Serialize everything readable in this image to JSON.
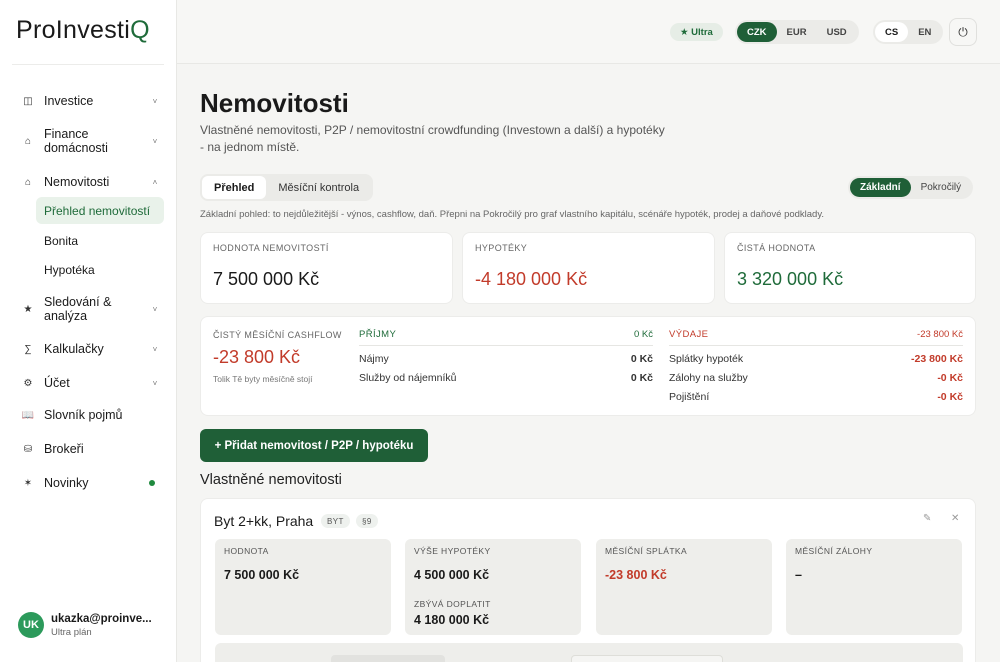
{
  "brand": {
    "name_main": "ProInvesti",
    "name_accent": "Q"
  },
  "sidebar": {
    "items": [
      {
        "id": "investice",
        "icon": "grid-icon",
        "glyph": "◫",
        "label": "Investice",
        "chevron": "˅"
      },
      {
        "id": "finance",
        "icon": "home-icon",
        "glyph": "⌂",
        "label": "Finance domácnosti",
        "chevron": "˅"
      },
      {
        "id": "nemovitosti",
        "icon": "house-icon",
        "glyph": "⌂",
        "label": "Nemovitosti",
        "chevron": "˄"
      },
      {
        "id": "sledovani",
        "icon": "star-icon",
        "glyph": "★",
        "label": "Sledování & analýza",
        "chevron": "˅"
      },
      {
        "id": "kalkulacky",
        "icon": "sigma-icon",
        "glyph": "∑",
        "label": "Kalkulačky",
        "chevron": "˅"
      },
      {
        "id": "ucet",
        "icon": "gear-icon",
        "glyph": "⚙",
        "label": "Účet",
        "chevron": "˅"
      },
      {
        "id": "slovnik",
        "icon": "book-icon",
        "glyph": "📖",
        "label": "Slovník pojmů",
        "chevron": ""
      },
      {
        "id": "brokeri",
        "icon": "database-icon",
        "glyph": "⛁",
        "label": "Brokeři",
        "chevron": ""
      },
      {
        "id": "novinky",
        "icon": "sparkle-icon",
        "glyph": "✶",
        "label": "Novinky",
        "chevron": ""
      }
    ],
    "subitems": [
      {
        "label": "Přehled nemovitostí",
        "active": true
      },
      {
        "label": "Bonita",
        "active": false
      },
      {
        "label": "Hypotéka",
        "active": false
      }
    ],
    "user": {
      "initials": "UK",
      "email": "ukazka@proinve...",
      "plan": "Ultra plán"
    }
  },
  "topbar": {
    "plan_badge": "★ Ultra",
    "currencies": [
      "CZK",
      "EUR",
      "USD"
    ],
    "currency_selected": "CZK",
    "languages": [
      "CS",
      "EN"
    ],
    "language_selected": "CS",
    "power_glyph": "⏻"
  },
  "page": {
    "title": "Nemovitosti",
    "subtitle": "Vlastněné nemovitosti, P2P / nemovitostní crowdfunding (Investown a další) a hypotéky - na jednom místě.",
    "tabs": [
      "Přehled",
      "Měsíční kontrola"
    ],
    "modes": [
      "Základní",
      "Pokročilý"
    ],
    "hint": "Základní pohled: to nejdůležitější - výnos, cashflow, daň. Přepni na Pokročilý pro graf vlastního kapitálu, scénáře hypoték, prodej a daňové podklady."
  },
  "kpis": [
    {
      "label": "HODNOTA NEMOVITOSTÍ",
      "value": "7 500 000 Kč",
      "tone": ""
    },
    {
      "label": "HYPOTÉKY",
      "value": "-4 180 000 Kč",
      "tone": "red"
    },
    {
      "label": "ČISTÁ HODNOTA",
      "value": "3 320 000 Kč",
      "tone": "green"
    }
  ],
  "cashflow": {
    "label": "ČISTÝ MĚSÍČNÍ CASHFLOW",
    "value": "-23 800 Kč",
    "note": "Tolik Tě byty měsíčně stojí",
    "income": {
      "title": "PŘÍJMY",
      "total": "0 Kč",
      "rows": [
        {
          "label": "Nájmy",
          "value": "0 Kč"
        },
        {
          "label": "Služby od nájemníků",
          "value": "0 Kč"
        }
      ]
    },
    "expenses": {
      "title": "VÝDAJE",
      "total": "-23 800 Kč",
      "rows": [
        {
          "label": "Splátky hypoték",
          "value": "-23 800 Kč"
        },
        {
          "label": "Zálohy na služby",
          "value": "-0 Kč"
        },
        {
          "label": "Pojištění",
          "value": "-0 Kč"
        }
      ]
    }
  },
  "add_button": "+ Přidat nemovitost / P2P / hypotéku",
  "owned": {
    "section_title": "Vlastněné nemovitosti",
    "property": {
      "name": "Byt 2+kk, Praha",
      "tags": [
        "BYT",
        "§9"
      ],
      "edit_glyph": "✎",
      "close_glyph": "✕",
      "tiles": [
        {
          "label": "HODNOTA",
          "value": "7 500 000 Kč",
          "tone": ""
        },
        {
          "label": "VÝŠE HYPOTÉKY",
          "value": "4 500 000 Kč",
          "tone": "",
          "label2": "ZBÝVÁ DOPLATIT",
          "value2": "4 180 000 Kč"
        },
        {
          "label": "MĚSÍČNÍ SPLÁTKA",
          "value": "-23 800 Kč",
          "tone": "red"
        },
        {
          "label": "MĚSÍČNÍ ZÁLOHY",
          "value": "–",
          "tone": ""
        }
      ]
    }
  }
}
